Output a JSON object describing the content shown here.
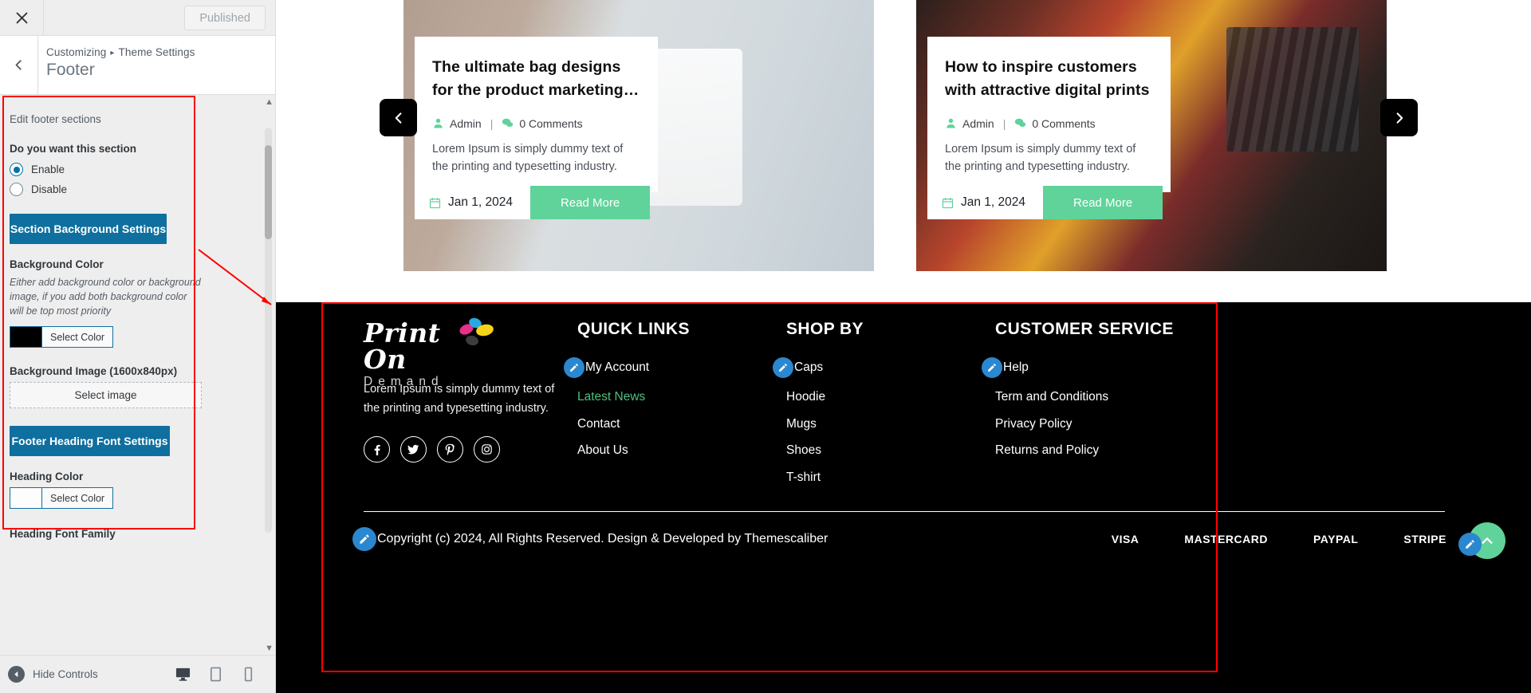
{
  "customizer": {
    "close_label": "Close",
    "published_label": "Published",
    "breadcrumb_root": "Customizing",
    "breadcrumb_sep": "▸",
    "breadcrumb_parent": "Theme Settings",
    "section_title": "Footer",
    "edit_sections_label": "Edit footer sections",
    "section_toggle": {
      "label": "Do you want this section",
      "options": [
        "Enable",
        "Disable"
      ],
      "selected": "Enable"
    },
    "section_bg_button": "Section Background Settings",
    "background_color": {
      "label": "Background Color",
      "description": "Either add background color or background image, if you add both background color will be top most priority",
      "button": "Select Color",
      "value": "#000000"
    },
    "background_image": {
      "label": "Background Image (1600x840px)",
      "button": "Select image"
    },
    "heading_font_button": "Footer Heading Font Settings",
    "heading_color": {
      "label": "Heading Color",
      "button": "Select Color",
      "value": "#ffffff"
    },
    "heading_font_family_label": "Heading Font Family",
    "hide_controls_label": "Hide Controls",
    "devices": [
      "desktop-icon",
      "tablet-icon",
      "mobile-icon"
    ],
    "accent_blue": "#0f6f9e",
    "highlight_red": "#ff0000"
  },
  "preview": {
    "blog_cards": [
      {
        "title": "The ultimate bag designs for the product marketing…",
        "author": "Admin",
        "comments": "0 Comments",
        "excerpt": "Lorem Ipsum is simply dummy text of the printing and typesetting industry.",
        "date": "Jan 1, 2024",
        "read_more": "Read More"
      },
      {
        "title": "How to inspire customers with attractive digital prints",
        "author": "Admin",
        "comments": "0 Comments",
        "excerpt": "Lorem Ipsum is simply dummy text of the printing and typesetting industry.",
        "date": "Jan 1, 2024",
        "read_more": "Read More"
      }
    ],
    "carousel": {
      "prev": "prev-arrow-icon",
      "next": "next-arrow-icon"
    },
    "footer": {
      "logo_script": "Print On",
      "logo_sub": "Demand",
      "about_text": "Lorem Ipsum is simply dummy text of the printing and typesetting industry.",
      "socials": [
        "facebook-icon",
        "twitter-icon",
        "pinterest-icon",
        "instagram-icon"
      ],
      "columns": [
        {
          "title": "QUICK LINKS",
          "links": [
            {
              "label": "My Account",
              "editable": true,
              "highlight": false
            },
            {
              "label": "Latest News",
              "editable": false,
              "highlight": true
            },
            {
              "label": "Contact",
              "editable": false,
              "highlight": false
            },
            {
              "label": "About Us",
              "editable": false,
              "highlight": false
            }
          ]
        },
        {
          "title": "SHOP BY",
          "links": [
            {
              "label": "Caps",
              "editable": true,
              "highlight": false
            },
            {
              "label": "Hoodie",
              "editable": false,
              "highlight": false
            },
            {
              "label": "Mugs",
              "editable": false,
              "highlight": false
            },
            {
              "label": "Shoes",
              "editable": false,
              "highlight": false
            },
            {
              "label": "T-shirt",
              "editable": false,
              "highlight": false
            }
          ]
        },
        {
          "title": "CUSTOMER SERVICE",
          "links": [
            {
              "label": "Help",
              "editable": true,
              "highlight": false
            },
            {
              "label": "Term and Conditions",
              "editable": false,
              "highlight": false
            },
            {
              "label": "Privacy Policy",
              "editable": false,
              "highlight": false
            },
            {
              "label": "Returns and Policy",
              "editable": false,
              "highlight": false
            }
          ]
        }
      ],
      "copyright": "Copyright (c) 2024, All Rights Reserved. Design & Developed by Themescaliber",
      "payments": [
        "VISA",
        "MASTERCARD",
        "PAYPAL",
        "STRIPE"
      ],
      "highlight_green": "#4fbf7a",
      "accent_green": "#5fd39a",
      "edit_badge_color": "#2b87cf"
    }
  }
}
